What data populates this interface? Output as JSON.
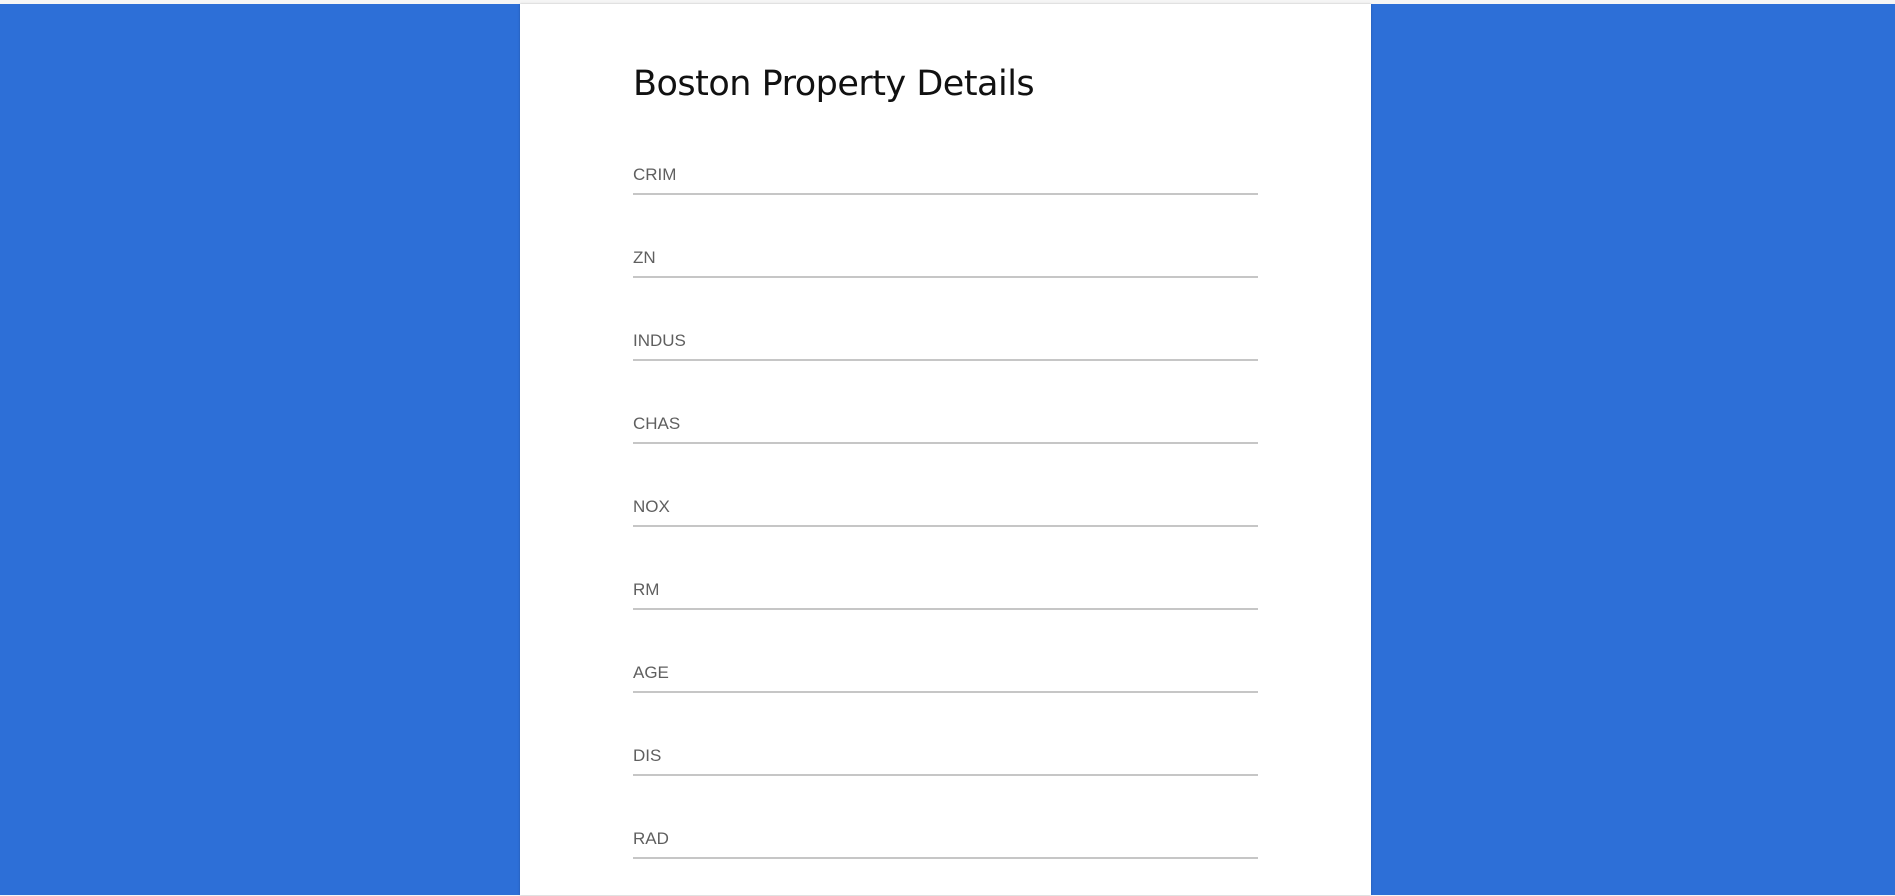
{
  "form": {
    "title": "Boston Property Details",
    "fields": [
      {
        "label": "CRIM",
        "value": ""
      },
      {
        "label": "ZN",
        "value": ""
      },
      {
        "label": "INDUS",
        "value": ""
      },
      {
        "label": "CHAS",
        "value": ""
      },
      {
        "label": "NOX",
        "value": ""
      },
      {
        "label": "RM",
        "value": ""
      },
      {
        "label": "AGE",
        "value": ""
      },
      {
        "label": "DIS",
        "value": ""
      },
      {
        "label": "RAD",
        "value": ""
      }
    ]
  },
  "colors": {
    "background": "#2d6fd7",
    "card": "#ffffff",
    "underline": "#c6c6c6",
    "label": "#5f5f5f"
  }
}
